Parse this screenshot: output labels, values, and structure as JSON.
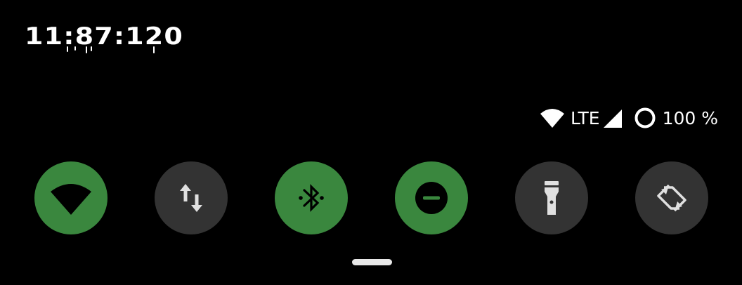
{
  "clock": {
    "time": "11:87:120"
  },
  "status_bar": {
    "network_label": "LTE",
    "battery_text": "100 %",
    "icons": [
      "wifi-icon",
      "signal-icon",
      "battery-icon"
    ]
  },
  "quick_settings": {
    "tiles": [
      {
        "id": "wifi",
        "icon": "wifi-icon",
        "state": "on"
      },
      {
        "id": "mobile-data",
        "icon": "data-arrows-icon",
        "state": "off"
      },
      {
        "id": "bluetooth",
        "icon": "bluetooth-icon",
        "state": "on"
      },
      {
        "id": "do-not-disturb",
        "icon": "dnd-icon",
        "state": "on"
      },
      {
        "id": "flashlight",
        "icon": "flashlight-icon",
        "state": "off"
      },
      {
        "id": "auto-rotate",
        "icon": "rotate-icon",
        "state": "off"
      }
    ]
  },
  "colors": {
    "background": "#000000",
    "tile_on": "#3a873e",
    "tile_off": "#333333",
    "icon_on": "#000000",
    "icon_off": "#e0e0e0"
  }
}
